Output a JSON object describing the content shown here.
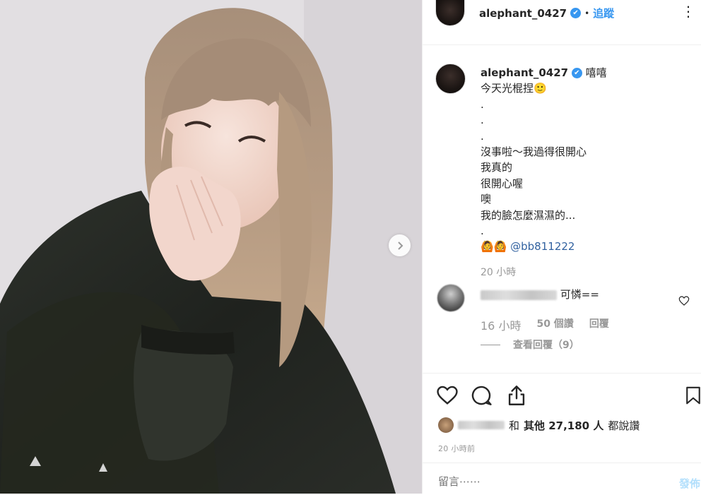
{
  "post": {
    "username": "alephant_0427",
    "follow_label": "追蹤",
    "verified_mark": "✔",
    "dots": "⋮"
  },
  "caption": {
    "username": "alephant_0427",
    "lines": [
      "嘻嘻",
      "今天光棍捏🙂",
      ".",
      ".",
      ".",
      "沒事啦～我過得很開心",
      "我真的",
      "很開心喔",
      "噢",
      "我的臉怎麼濕濕的...",
      "."
    ],
    "emoji_prefix": "🙆🙆",
    "mention": "@bb811222",
    "time": "20 小時"
  },
  "comment": {
    "text": "可憐==",
    "time": "16 小時",
    "likes": "50 個讚",
    "reply_label": "回覆",
    "view_replies": "查看回覆（9）"
  },
  "likes": {
    "conjunction": "和",
    "count_text": "其他 27,180 人",
    "suffix": "都說讚"
  },
  "posted_ago": "20 小時前",
  "comment_box": {
    "placeholder": "留言⋯⋯",
    "post_label": "發佈"
  },
  "colors": {
    "accent": "#3897f0",
    "mention": "#3262a0",
    "muted": "#999999"
  },
  "icons": [
    "heart-icon",
    "comment-icon",
    "share-icon",
    "bookmark-icon",
    "chevron-right-icon",
    "more-icon",
    "verified-icon"
  ]
}
